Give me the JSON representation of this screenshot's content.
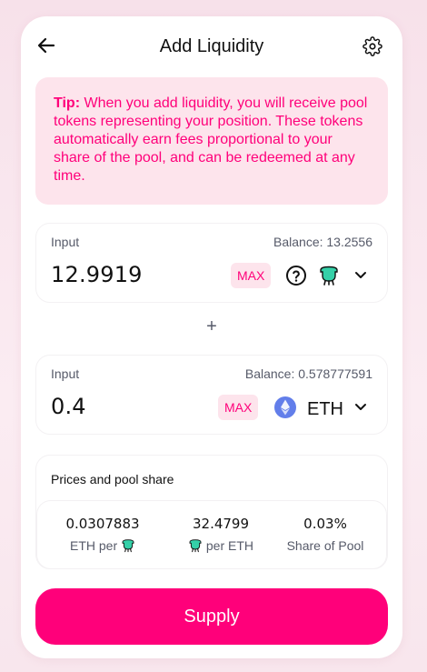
{
  "header": {
    "title": "Add Liquidity",
    "back_icon": "arrow-left-icon",
    "settings_icon": "gear-icon"
  },
  "tip": {
    "label": "Tip:",
    "text": " When you add liquidity, you will receive pool tokens representing your position. These tokens automatically earn fees proportional to your share of the pool, and can be redeemed at any time."
  },
  "input_a": {
    "label": "Input",
    "balance": "Balance: 13.2556",
    "amount": "12.9919",
    "max_label": "MAX",
    "token_icons": [
      "question-circle-icon",
      "token-logo-icon"
    ]
  },
  "plus": "+",
  "input_b": {
    "label": "Input",
    "balance": "Balance: 0.578777591",
    "amount": "0.4",
    "max_label": "MAX",
    "token_symbol": "ETH",
    "token_icon": "eth-logo-icon"
  },
  "pool": {
    "title": "Prices and pool share",
    "stats": [
      {
        "value": "0.0307883",
        "label_pre": "ETH per",
        "label_post": ""
      },
      {
        "value": "32.4799",
        "label_pre": "",
        "label_post": "per ETH"
      },
      {
        "value": "0.03%",
        "label_pre": "Share of Pool",
        "label_post": ""
      }
    ]
  },
  "supply_label": "Supply",
  "colors": {
    "accent": "#ff007a",
    "tip_bg": "#fde4ec",
    "eth": "#627eea",
    "token": "#35d0a8"
  }
}
